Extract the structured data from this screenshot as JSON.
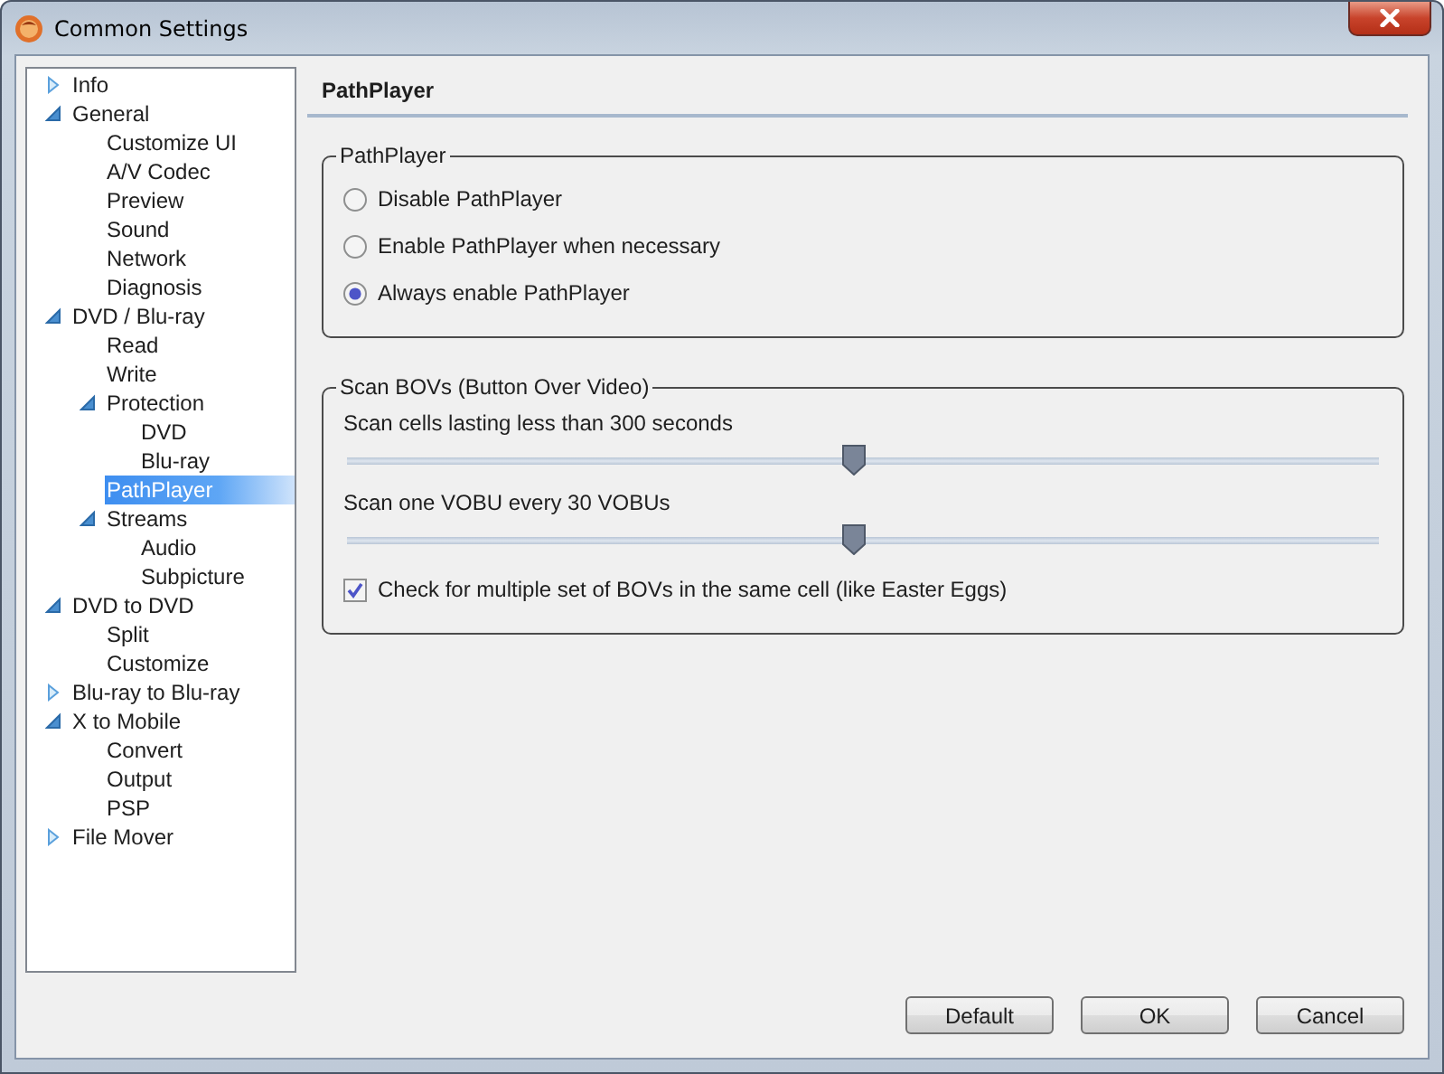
{
  "window": {
    "title": "Common Settings"
  },
  "tree": [
    {
      "label": "Info",
      "expanded": false,
      "selected": false
    },
    {
      "label": "General",
      "expanded": true,
      "selected": false,
      "children": [
        {
          "label": "Customize UI",
          "selected": false
        },
        {
          "label": "A/V Codec",
          "selected": false
        },
        {
          "label": "Preview",
          "selected": false
        },
        {
          "label": "Sound",
          "selected": false
        },
        {
          "label": "Network",
          "selected": false
        },
        {
          "label": "Diagnosis",
          "selected": false
        }
      ]
    },
    {
      "label": "DVD / Blu-ray",
      "expanded": true,
      "selected": false,
      "children": [
        {
          "label": "Read",
          "selected": false
        },
        {
          "label": "Write",
          "selected": false
        },
        {
          "label": "Protection",
          "expanded": true,
          "selected": false,
          "children": [
            {
              "label": "DVD",
              "selected": false
            },
            {
              "label": "Blu-ray",
              "selected": false
            }
          ]
        },
        {
          "label": "PathPlayer",
          "selected": true
        },
        {
          "label": "Streams",
          "expanded": true,
          "selected": false,
          "children": [
            {
              "label": "Audio",
              "selected": false
            },
            {
              "label": "Subpicture",
              "selected": false
            }
          ]
        }
      ]
    },
    {
      "label": "DVD to DVD",
      "expanded": true,
      "selected": false,
      "children": [
        {
          "label": "Split",
          "selected": false
        },
        {
          "label": "Customize",
          "selected": false
        }
      ]
    },
    {
      "label": "Blu-ray to Blu-ray",
      "expanded": false,
      "selected": false
    },
    {
      "label": "X to Mobile",
      "expanded": true,
      "selected": false,
      "children": [
        {
          "label": "Convert",
          "selected": false
        },
        {
          "label": "Output",
          "selected": false
        },
        {
          "label": "PSP",
          "selected": false
        }
      ]
    },
    {
      "label": "File Mover",
      "expanded": false,
      "selected": false
    }
  ],
  "page": {
    "heading": "PathPlayer",
    "groups": [
      {
        "title": "PathPlayer",
        "items": [
          {
            "kind": "radio",
            "label": "Disable PathPlayer",
            "selected": false
          },
          {
            "kind": "radio",
            "label": "Enable PathPlayer when necessary",
            "selected": false
          },
          {
            "kind": "radio",
            "label": "Always enable PathPlayer",
            "selected": true
          }
        ]
      },
      {
        "title": "Scan BOVs (Button Over Video)",
        "items": [
          {
            "kind": "slider",
            "label": "Scan cells lasting less than 300 seconds",
            "level": 0.49
          },
          {
            "kind": "slider",
            "label": "Scan one VOBU every 30 VOBUs",
            "level": 0.49
          },
          {
            "kind": "checkbox",
            "label": "Check for multiple set of BOVs in the same cell (like Easter Eggs)",
            "checked": true
          }
        ]
      }
    ]
  },
  "buttons": [
    "Default",
    "OK",
    "Cancel"
  ]
}
